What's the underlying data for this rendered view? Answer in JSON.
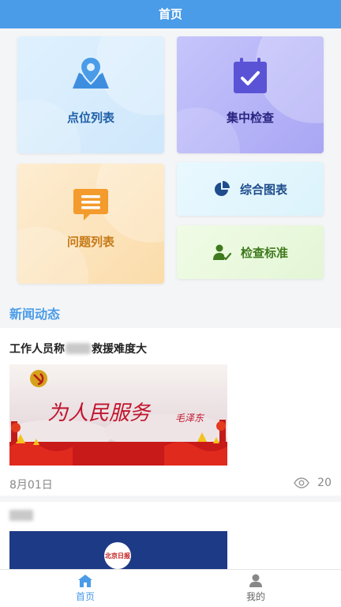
{
  "header": {
    "title": "首页"
  },
  "grid": {
    "point_list": {
      "label": "点位列表",
      "icon": "map-pin-icon"
    },
    "focus_check": {
      "label": "集中检查",
      "icon": "calendar-check-icon"
    },
    "issue_list": {
      "label": "问题列表",
      "icon": "chat-list-icon"
    },
    "charts": {
      "label": "综合图表",
      "icon": "pie-chart-icon"
    },
    "standards": {
      "label": "检查标准",
      "icon": "person-check-icon"
    }
  },
  "news": {
    "section_title": "新闻动态",
    "items": [
      {
        "title_prefix": "工作人员称",
        "title_suffix": "救援难度大",
        "image_text": "为人民服务",
        "image_signature": "毛泽东",
        "date": "8月01日",
        "views": "20"
      },
      {
        "logo_text": "北京日报"
      }
    ]
  },
  "tabbar": {
    "home": {
      "label": "首页",
      "icon": "home-icon"
    },
    "mine": {
      "label": "我的",
      "icon": "user-icon"
    }
  },
  "colors": {
    "primary": "#4a9ce8",
    "background": "#f4f5f7"
  }
}
